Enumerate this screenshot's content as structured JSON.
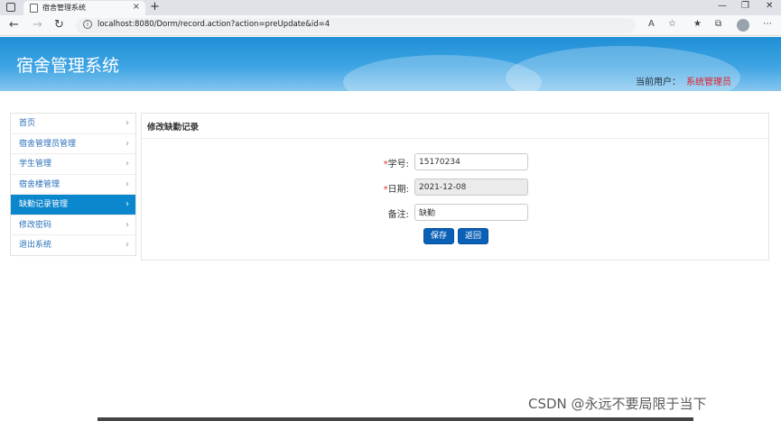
{
  "browser": {
    "tab_title": "宿舍管理系统",
    "tab_close": "×",
    "new_tab": "+",
    "url": "localhost:8080/Dorm/record.action?action=preUpdate&id=4",
    "window_controls": [
      "—",
      "❐",
      "✕"
    ]
  },
  "header": {
    "system_title": "宿舍管理系统",
    "current_user_label": "当前用户：",
    "current_user_name": "系统管理员"
  },
  "sidebar": {
    "items": [
      {
        "label": "首页",
        "active": false
      },
      {
        "label": "宿舍管理员管理",
        "active": false
      },
      {
        "label": "学生管理",
        "active": false
      },
      {
        "label": "宿舍楼管理",
        "active": false
      },
      {
        "label": "缺勤记录管理",
        "active": true
      },
      {
        "label": "修改密码",
        "active": false
      },
      {
        "label": "退出系统",
        "active": false
      }
    ],
    "chevron": "›"
  },
  "panel": {
    "title": "修改缺勤记录",
    "form": {
      "student_id": {
        "required_mark": "*",
        "label": "学号:",
        "value": "15170234"
      },
      "date": {
        "required_mark": "*",
        "label": "日期:",
        "value": "2021-12-08"
      },
      "remark": {
        "label": "备注:",
        "value": "缺勤"
      }
    },
    "save_label": "保存",
    "back_label": "返回"
  },
  "watermark": "CSDN @永远不要局限于当下",
  "colors": {
    "accent": "#0b87cd",
    "button": "#0a60b6",
    "user_name": "#e0202a",
    "required": "#d9342b"
  }
}
